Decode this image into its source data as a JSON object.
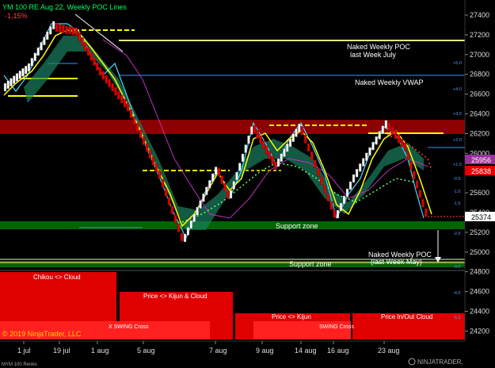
{
  "header": {
    "title": "YM 100 RE Aug 22, Weekly POC Lines",
    "change": "-1,15%"
  },
  "annotations": {
    "naked_poc_july_1": "Naked Weekly POC",
    "naked_poc_july_2": "last Week July",
    "naked_vwap": "Naked Weekly VWAP",
    "support_zone_1": "Support zone",
    "naked_poc_may_1": "Naked Weekly POC",
    "naked_poc_may_2": "(last Week May)",
    "support_zone_2": "Support zone"
  },
  "lower_panel": {
    "labels": {
      "chikou": "Chikou <> Cloud",
      "price_kijun_cloud": "Price <> Kijun & Cloud",
      "x_swing": "X SWING Cross",
      "price_kijun": "Price <> Kijun",
      "swing_cross": "SWING Cross",
      "price_inout": "Price In/Out Cloud"
    },
    "copyright": "© 2019 NinjaTrader, LLC"
  },
  "price_axis": {
    "ticks": [
      "27400",
      "27200",
      "27000",
      "26800",
      "26600",
      "26400",
      "26200",
      "26000",
      "25800",
      "25600",
      "25400",
      "25200",
      "25000",
      "24800",
      "24600",
      "24400",
      "24200"
    ],
    "badges": {
      "purple": "25956",
      "red": "25838",
      "white": "25374"
    },
    "dev_labels": [
      "+5.0",
      "+4.0",
      "+3.0",
      "+2.0",
      "+1.0",
      "-0.5",
      "-1.0",
      "-1.5",
      "-2.0",
      "-3.0",
      "-4.0",
      "-5.0"
    ]
  },
  "time_axis": {
    "labels": [
      "1 jul",
      "19 jul",
      "1 aug",
      "5 aug",
      "7 aug",
      "9 aug",
      "14 aug",
      "16 aug",
      "23 aug"
    ]
  },
  "footer": {
    "instrument": "MYM 100 Renko",
    "brand": "NINJATRADER."
  },
  "colors": {
    "background": "#000000",
    "resistance_zone": "#8b0000",
    "support_zone": "#006400",
    "lower_panel": "#e00000",
    "poc_line": "#f0f080",
    "vwap_line": "#3399ff",
    "price_line": "#ffff00",
    "cyan_line": "#40e0ff"
  },
  "chart_data": {
    "type": "line",
    "title": "YM 100 RE Aug 22, Weekly POC Lines",
    "y_range": [
      24150,
      27480
    ],
    "price_path": [
      [
        27200,
        "1 jul"
      ],
      [
        26580,
        null
      ],
      [
        26900,
        null
      ],
      [
        27300,
        "19 jul"
      ],
      [
        27200,
        null
      ],
      [
        26850,
        "1 aug"
      ],
      [
        26400,
        null
      ],
      [
        25800,
        "5 aug"
      ],
      [
        25150,
        null
      ],
      [
        25700,
        "7 aug"
      ],
      [
        25500,
        null
      ],
      [
        26350,
        "9 aug"
      ],
      [
        25800,
        null
      ],
      [
        26300,
        "14 aug"
      ],
      [
        25500,
        "16 aug"
      ],
      [
        26350,
        null
      ],
      [
        26200,
        "23 aug"
      ],
      [
        25374,
        null
      ]
    ],
    "levels": {
      "naked_weekly_poc_july": 27180,
      "naked_weekly_vwap": 26785,
      "resistance_zone": [
        26230,
        26360
      ],
      "support_zone": [
        25270,
        25370
      ],
      "naked_weekly_poc_may": 24920,
      "last_price": 25374
    }
  }
}
